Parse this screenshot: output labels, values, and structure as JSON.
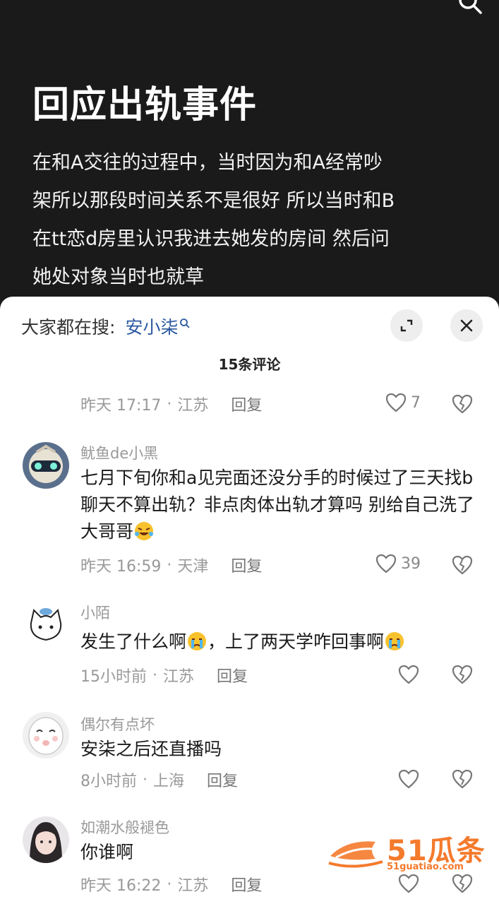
{
  "post": {
    "title": "回应出轨事件",
    "body": "在和A交往的过程中，当时因为和A经常吵架所以那段时间关系不是很好 所以当时和B在tt恋d房里认识我进去她发的房间 然后问她处对象当时也就草"
  },
  "sheet": {
    "search_prefix": "大家都在搜:",
    "search_term": "安小柒",
    "comment_count": "15条评论"
  },
  "comments": [
    {
      "time": "昨天 17:17",
      "location": "江苏",
      "reply": "回复",
      "likes": "7"
    },
    {
      "user": "鱿鱼de小黑",
      "text": "七月下旬你和a见完面还没分手的时候过了三天找b聊天不算出轨？非点肉体出轨才算吗 别给自己洗了大哥哥",
      "time": "昨天 16:59",
      "location": "天津",
      "reply": "回复",
      "likes": "39"
    },
    {
      "user": "小陌",
      "text_a": "发生了什么啊",
      "text_b": "，上了两天学咋回事啊",
      "time": "15小时前",
      "location": "江苏",
      "reply": "回复",
      "likes": ""
    },
    {
      "user": "偶尔有点坏",
      "text": "安柒之后还直播吗",
      "time": "8小时前",
      "location": "上海",
      "reply": "回复",
      "likes": ""
    },
    {
      "user": "如潮水般褪色",
      "text": "你谁啊",
      "time": "昨天 16:22",
      "location": "江苏",
      "reply": "回复",
      "likes": ""
    }
  ],
  "watermark": {
    "brand": "51瓜条",
    "url": "51guatiao.com"
  },
  "colors": {
    "accent_link": "#2c5aa0",
    "watermark": "#f47a2c"
  }
}
